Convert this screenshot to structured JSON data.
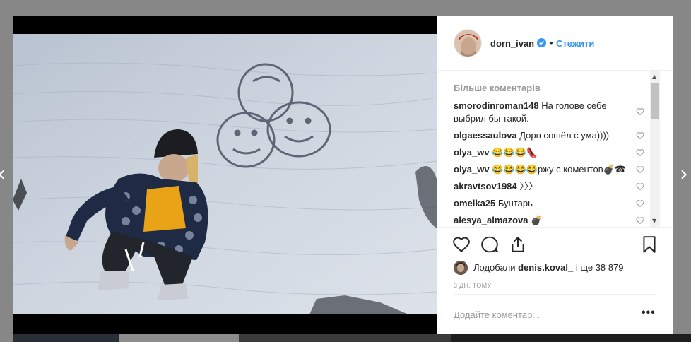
{
  "post": {
    "username": "dorn_ivan",
    "separator": "•",
    "follow_label": "Стежити"
  },
  "comments": {
    "more_label": "Більше коментарів",
    "items": [
      {
        "author": "smorodinroman148",
        "text": "На голове себе выбрил бы такой."
      },
      {
        "author": "olgaessaulova",
        "text": "Дорн сошёл с ума))))"
      },
      {
        "author": "olya_wv",
        "text": "😂😂😂👠"
      },
      {
        "author": "olya_wv",
        "text": "😂😂😂😂ржу с коментов💣☎"
      },
      {
        "author": "akravtsov1984",
        "text": "〉〉〉"
      },
      {
        "author": "omelka25",
        "text": "Бунтарь"
      },
      {
        "author": "alesya_almazova",
        "text": "💣"
      }
    ]
  },
  "likes": {
    "prefix": "Лодобали",
    "liker": "denis.koval_",
    "suffix": "і ще 38 879"
  },
  "timestamp": "3 ДН. ТОМУ",
  "add_comment": {
    "placeholder": "Додайте коментар...",
    "more": "•••"
  },
  "nav": {
    "prev": "‹",
    "next": "›"
  },
  "icons": {
    "like": "heart-icon",
    "comment": "comment-bubble-icon",
    "share": "share-icon",
    "save": "bookmark-icon"
  },
  "colors": {
    "link": "#3897f0",
    "verified": "#3897f0",
    "text": "#262626",
    "muted": "#999999"
  }
}
